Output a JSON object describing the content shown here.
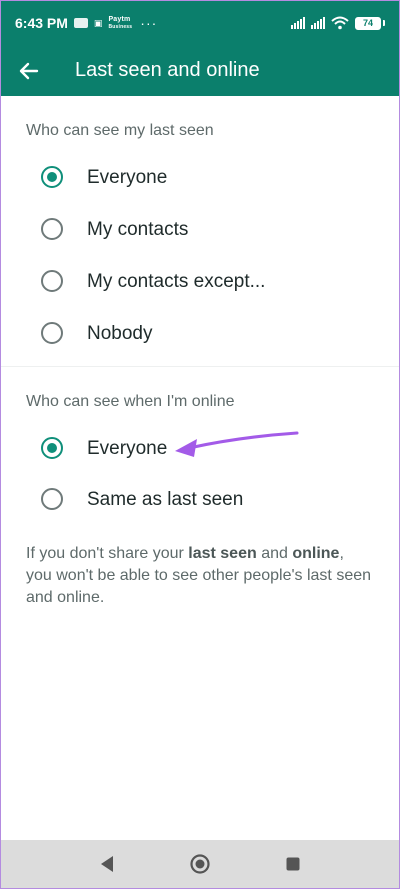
{
  "status_bar": {
    "time": "6:43 PM",
    "paytm_text": "Paytm",
    "paytm_sub": "Business",
    "more": "···",
    "battery": "74"
  },
  "app_bar": {
    "title": "Last seen and online",
    "back_icon": "arrow-left-icon"
  },
  "last_seen": {
    "title": "Who can see my last seen",
    "options": [
      {
        "label": "Everyone",
        "selected": true
      },
      {
        "label": "My contacts",
        "selected": false
      },
      {
        "label": "My contacts except...",
        "selected": false
      },
      {
        "label": "Nobody",
        "selected": false
      }
    ]
  },
  "online": {
    "title": "Who can see when I'm online",
    "options": [
      {
        "label": "Everyone",
        "selected": true
      },
      {
        "label": "Same as last seen",
        "selected": false
      }
    ]
  },
  "info": {
    "part1": "If you don't share your ",
    "bold1": "last seen",
    "part2": " and ",
    "bold2": "online",
    "part3": ", you won't be able to see other people's last seen and online."
  },
  "colors": {
    "header": "#0b7f6c",
    "accent": "#0f8f7a",
    "annotation_arrow": "#a35be8"
  },
  "nav": {
    "back_icon": "triangle-back-icon",
    "home_icon": "circle-home-icon",
    "recents_icon": "square-recents-icon"
  }
}
